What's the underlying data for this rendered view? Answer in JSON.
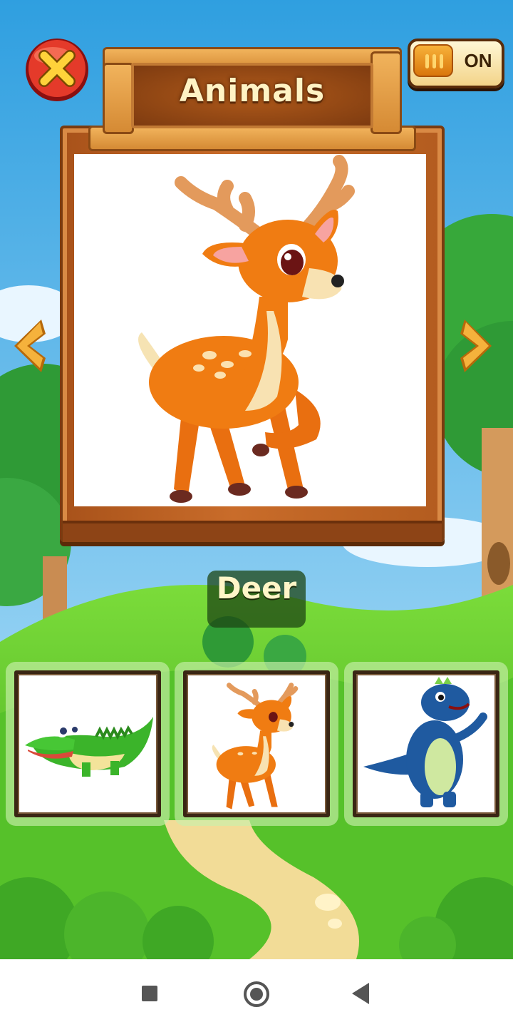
{
  "header": {
    "title": "Animals",
    "close_icon": "close-x-icon",
    "sound_toggle": {
      "label": "ON",
      "state": "on"
    }
  },
  "current_animal": {
    "name": "Deer",
    "image": "deer-illustration"
  },
  "navigation": {
    "prev_icon": "chevron-left-icon",
    "next_icon": "chevron-right-icon"
  },
  "thumbnails": [
    {
      "animal": "crocodile",
      "icon": "crocodile-illustration"
    },
    {
      "animal": "deer",
      "icon": "deer-illustration"
    },
    {
      "animal": "dinosaur",
      "icon": "dinosaur-illustration"
    }
  ],
  "system_nav": {
    "recent_icon": "square-recent-icon",
    "home_icon": "circle-home-icon",
    "back_icon": "triangle-back-icon"
  },
  "colors": {
    "sky": "#3fa9e6",
    "grass": "#5cc52c",
    "wood": "#c96c2a",
    "title_text": "#fff3c4"
  }
}
